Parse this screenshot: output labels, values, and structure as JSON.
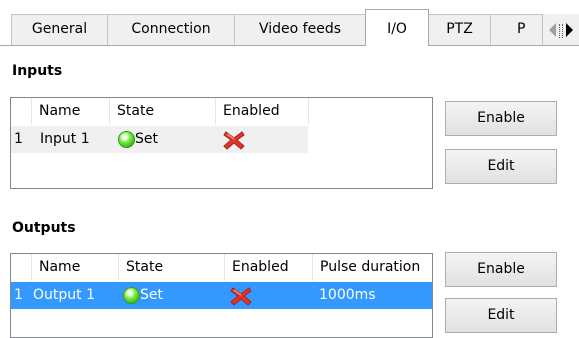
{
  "tabs": [
    {
      "label": "General",
      "active": false
    },
    {
      "label": "Connection",
      "active": false
    },
    {
      "label": "Video feeds",
      "active": false
    },
    {
      "label": "I/O",
      "active": true
    },
    {
      "label": "PTZ",
      "active": false
    },
    {
      "label": "P",
      "active": false
    }
  ],
  "inputs": {
    "title": "Inputs",
    "columns": [
      "Name",
      "State",
      "Enabled"
    ],
    "rows": [
      {
        "index": "1",
        "name": "Input 1",
        "state": "Set",
        "enabled": false
      }
    ],
    "buttons": {
      "enable": "Enable",
      "edit": "Edit"
    }
  },
  "outputs": {
    "title": "Outputs",
    "columns": [
      "Name",
      "State",
      "Enabled",
      "Pulse duration"
    ],
    "rows": [
      {
        "index": "1",
        "name": "Output 1",
        "state": "Set",
        "enabled": false,
        "pulse": "1000ms",
        "selected": true
      }
    ],
    "buttons": {
      "enable": "Enable",
      "edit": "Edit"
    }
  },
  "icons": {
    "state_on": "green-led-icon",
    "disabled": "red-x-icon"
  },
  "colors": {
    "selection": "#3399ff",
    "led": "#4cd62a",
    "x_mark": "#e0352b"
  }
}
